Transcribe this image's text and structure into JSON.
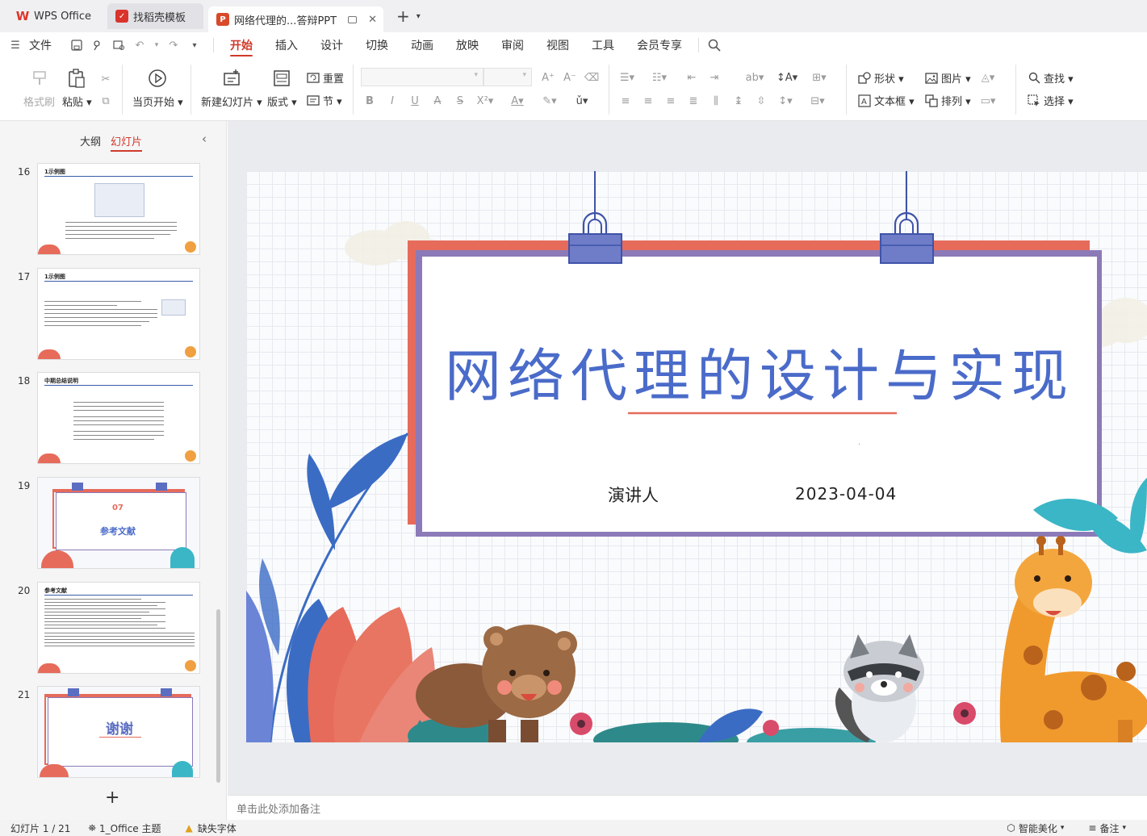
{
  "tabs": [
    {
      "label": "WPS Office",
      "color": "#e0332a"
    },
    {
      "label": "找稻壳模板",
      "color": "#d9332b"
    },
    {
      "label": "网络代理的...答辩PPT",
      "color": "#d84a2a",
      "active": true
    }
  ],
  "menubar": {
    "file": "文件",
    "ribbon_tabs": [
      "开始",
      "插入",
      "设计",
      "切换",
      "动画",
      "放映",
      "审阅",
      "视图",
      "工具",
      "会员专享"
    ],
    "active_tab": "开始"
  },
  "ribbon": {
    "format_painter": "格式刷",
    "paste": "粘贴",
    "play_from_current": "当页开始",
    "new_slide": "新建幻灯片",
    "layout": "版式",
    "reset": "重置",
    "section": "节",
    "shape": "形状",
    "picture": "图片",
    "textbox": "文本框",
    "arrange": "排列",
    "find": "查找",
    "select": "选择"
  },
  "left_panel": {
    "outline_tab": "大纲",
    "slides_tab": "幻灯片",
    "slides": [
      {
        "num": "16",
        "title": "1示例图"
      },
      {
        "num": "17",
        "title": "1示例图"
      },
      {
        "num": "18",
        "title": "中期总结说明"
      },
      {
        "num": "19",
        "number": "07",
        "title": "参考文献"
      },
      {
        "num": "20",
        "title": "参考文献"
      },
      {
        "num": "21",
        "title": "谢谢"
      }
    ],
    "add_label": "+"
  },
  "slide": {
    "title": "网络代理的设计与实现",
    "presenter": "演讲人",
    "date": "2023-04-04",
    "dot": "·"
  },
  "notes_placeholder": "单击此处添加备注",
  "status": {
    "slide_counter": "幻灯片 1 / 21",
    "theme": "1_Office 主题",
    "missing_font": "缺失字体",
    "smart_beautify": "智能美化",
    "notes": "备注"
  },
  "colors": {
    "accent": "#d03a2a",
    "title_blue": "#4a6bc9",
    "frame_red": "#e66b5b",
    "frame_purple": "#8c7ab8",
    "clip_blue": "#5b6ec2"
  }
}
